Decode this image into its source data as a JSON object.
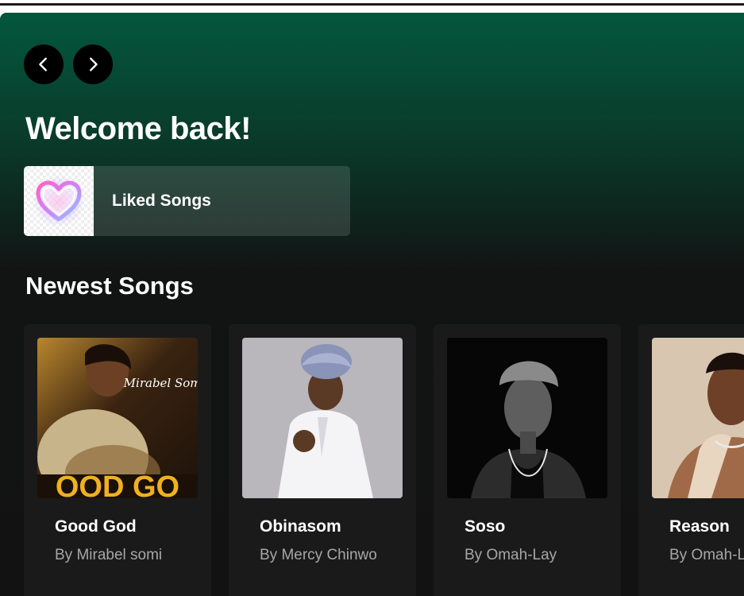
{
  "header": {
    "welcome": "Welcome back!"
  },
  "nav": {
    "back_icon": "chevron-left-icon",
    "forward_icon": "chevron-right-icon"
  },
  "liked": {
    "label": "Liked Songs",
    "icon": "heart-icon"
  },
  "newest": {
    "title": "Newest Songs",
    "songs": [
      {
        "title": "Good God",
        "artist": "By Mirabel somi",
        "cover_text": "Mirabel Somi",
        "cover_banner": "OOD GO"
      },
      {
        "title": "Obinasom",
        "artist": "By Mercy Chinwo"
      },
      {
        "title": "Soso",
        "artist": "By Omah-Lay"
      },
      {
        "title": "Reason",
        "artist": "By Omah-Lay"
      }
    ]
  },
  "colors": {
    "gradient_top": "#03573d",
    "background": "#121212",
    "card": "#1a1a1a",
    "text_primary": "#ffffff",
    "text_secondary": "#a7a7a7"
  }
}
